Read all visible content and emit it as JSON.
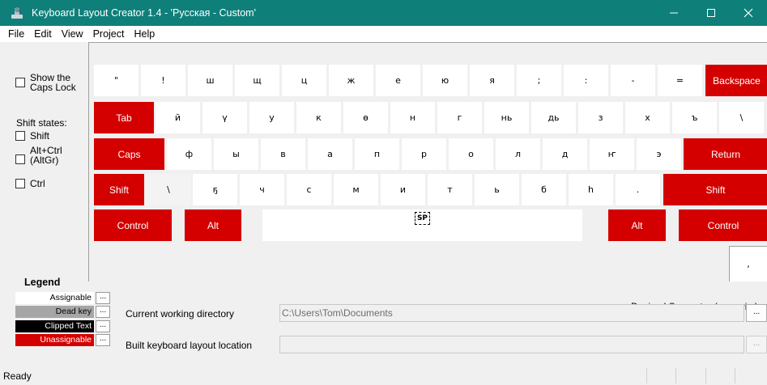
{
  "window": {
    "title": "Keyboard Layout Creator 1.4 - 'Русская - Custom'"
  },
  "menu": [
    "File",
    "Edit",
    "View",
    "Project",
    "Help"
  ],
  "left_panel": {
    "show_caps_lock": "Show the\nCaps Lock",
    "shift_states_label": "Shift states:",
    "shift": "Shift",
    "altgr": "Alt+Ctrl\n(AltGr)",
    "ctrl": "Ctrl"
  },
  "keyboard": {
    "row1": [
      "\"",
      "!",
      "ш",
      "щ",
      "ц",
      "ж",
      "е",
      "ю",
      "я",
      ";",
      ":",
      "-",
      "="
    ],
    "backspace": "Backspace",
    "tab": "Tab",
    "row2": [
      "й",
      "ү",
      "у",
      "к",
      "ө",
      "н",
      "г",
      "нь",
      "дь",
      "з",
      "х",
      "ъ",
      "\\"
    ],
    "caps": "Caps",
    "row3": [
      "ф",
      "ы",
      "в",
      "а",
      "п",
      "р",
      "о",
      "л",
      "д",
      "ҥ",
      "э"
    ],
    "return": "Return",
    "shift_left": "Shift",
    "row4": [
      "\\",
      "ҕ",
      "ч",
      "с",
      "м",
      "и",
      "т",
      "ь",
      "б",
      "һ",
      "."
    ],
    "shift_right": "Shift",
    "control_left": "Control",
    "alt_left": "Alt",
    "space": "SP",
    "alt_right": "Alt",
    "control_right": "Control",
    "decimal_separator_label": "Decimal Separator (numeric keypad)",
    "decimal_key": ","
  },
  "legend": {
    "title": "Legend",
    "items": [
      {
        "label": "Assignable",
        "bg": "#ffffff",
        "fg": "#000000"
      },
      {
        "label": "Dead key",
        "bg": "#a6a6a6",
        "fg": "#000000"
      },
      {
        "label": "Clipped Text",
        "bg": "#000000",
        "fg": "#ffffff"
      },
      {
        "label": "Unassignable",
        "bg": "#d40000",
        "fg": "#ffffff"
      }
    ],
    "button": "..."
  },
  "fields": {
    "cwd_label": "Current working directory",
    "cwd_value": "C:\\Users\\Tom\\Documents",
    "built_label": "Built keyboard layout location",
    "built_value": "",
    "browse": "..."
  },
  "status": {
    "text": "Ready"
  },
  "colors": {
    "titlebar": "#0f7f7a",
    "unassignable": "#d40000",
    "assignable": "#ffffff"
  }
}
